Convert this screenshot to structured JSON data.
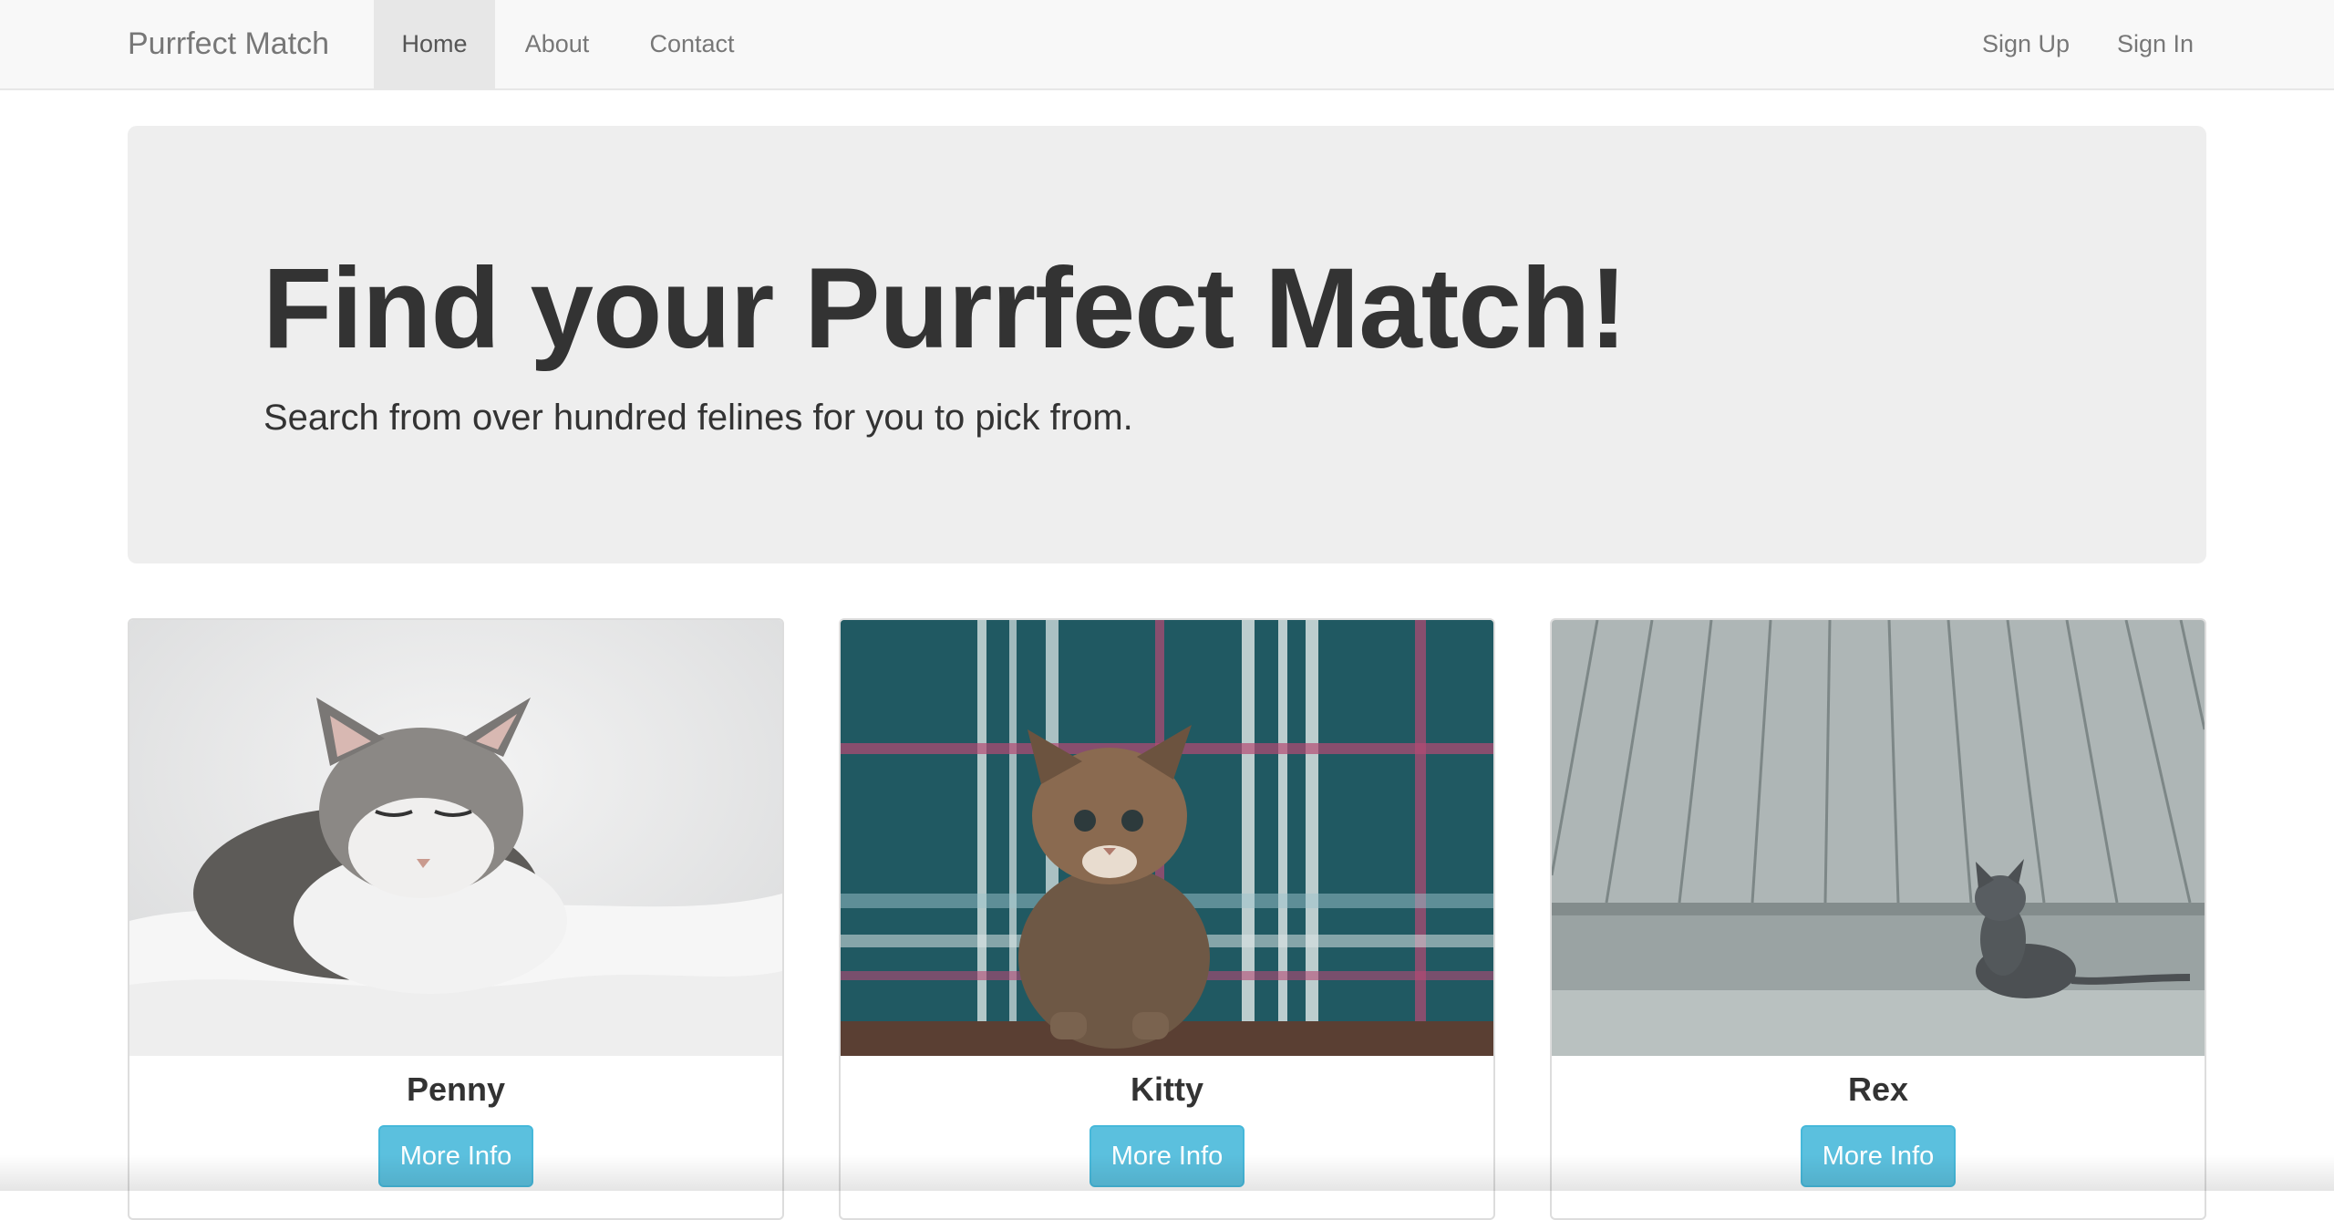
{
  "navbar": {
    "brand": "Purrfect Match",
    "links": [
      {
        "label": "Home",
        "active": true
      },
      {
        "label": "About",
        "active": false
      },
      {
        "label": "Contact",
        "active": false
      }
    ],
    "right_links": [
      {
        "label": "Sign Up"
      },
      {
        "label": "Sign In"
      }
    ]
  },
  "hero": {
    "title": "Find your Purrfect Match!",
    "subtitle": "Search from over hundred felines for you to pick from."
  },
  "cats": [
    {
      "name": "Penny",
      "button_label": "More Info",
      "photo": "white-and-grey-cat-photo"
    },
    {
      "name": "Kitty",
      "button_label": "More Info",
      "photo": "tabby-kitten-on-plaid-photo"
    },
    {
      "name": "Rex",
      "button_label": "More Info",
      "photo": "grey-kitten-by-deck-photo"
    }
  ],
  "colors": {
    "navbar_bg": "#f8f8f8",
    "active_tab_bg": "#e7e7e7",
    "jumbotron_bg": "#eeeeee",
    "info_button": "#5bc0de"
  }
}
